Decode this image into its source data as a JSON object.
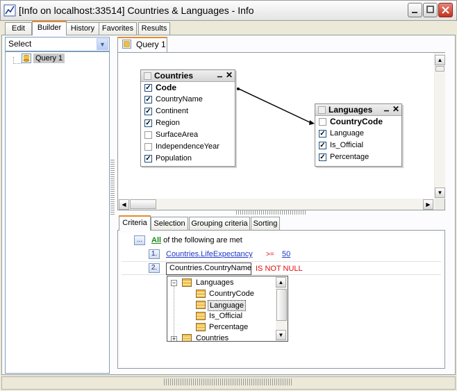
{
  "window": {
    "title": "[Info on localhost:33514] Countries & Languages - Info",
    "app_icon": "chart-icon",
    "controls": [
      "minimize-icon",
      "maximize-icon",
      "close-icon"
    ]
  },
  "tabs": [
    {
      "label": "Edit",
      "active": false
    },
    {
      "label": "Builder",
      "active": true
    },
    {
      "label": "History",
      "active": false
    },
    {
      "label": "Favorites",
      "active": false
    },
    {
      "label": "Results",
      "active": false
    }
  ],
  "left_panel": {
    "select_value": "Select",
    "tree": [
      {
        "label": "Query 1",
        "icon": "query-icon",
        "selected": true
      }
    ]
  },
  "query_tab": {
    "label": "Query 1"
  },
  "diagram": {
    "tables": [
      {
        "name": "Countries",
        "fields": [
          {
            "name": "Code",
            "checked": true,
            "key": true
          },
          {
            "name": "CountryName",
            "checked": true
          },
          {
            "name": "Continent",
            "checked": true
          },
          {
            "name": "Region",
            "checked": true
          },
          {
            "name": "SurfaceArea",
            "checked": false
          },
          {
            "name": "IndependenceYear",
            "checked": false
          },
          {
            "name": "Population",
            "checked": true
          }
        ]
      },
      {
        "name": "Languages",
        "fields": [
          {
            "name": "CountryCode",
            "checked": false,
            "key": true
          },
          {
            "name": "Language",
            "checked": true
          },
          {
            "name": "Is_Official",
            "checked": true
          },
          {
            "name": "Percentage",
            "checked": true
          }
        ]
      }
    ]
  },
  "bottom_tabs": [
    {
      "label": "Criteria",
      "active": true
    },
    {
      "label": "Selection",
      "active": false
    },
    {
      "label": "Grouping criteria",
      "active": false
    },
    {
      "label": "Sorting",
      "active": false
    }
  ],
  "criteria": {
    "more_button": "...",
    "quantifier": "All",
    "header_rest": "of the following are met",
    "rows": [
      {
        "num": "1.",
        "field": "Countries.LifeExpectancy",
        "op": ">=",
        "value": "50"
      },
      {
        "num": "2.",
        "field": "Countries.CountryName",
        "op": "IS NOT NULL",
        "value": ""
      }
    ],
    "dropdown": {
      "items": [
        {
          "label": "Languages",
          "type": "table",
          "expanded": true
        },
        {
          "label": "CountryCode",
          "type": "field"
        },
        {
          "label": "Language",
          "type": "field",
          "selected": true
        },
        {
          "label": "Is_Official",
          "type": "field"
        },
        {
          "label": "Percentage",
          "type": "field"
        },
        {
          "label": "Countries",
          "type": "table",
          "expanded": false
        }
      ]
    }
  },
  "colors": {
    "accent_tab": "#e68b2c",
    "link": "#1f36c7",
    "operator": "#e01010",
    "all_link": "#1a8a1a"
  }
}
